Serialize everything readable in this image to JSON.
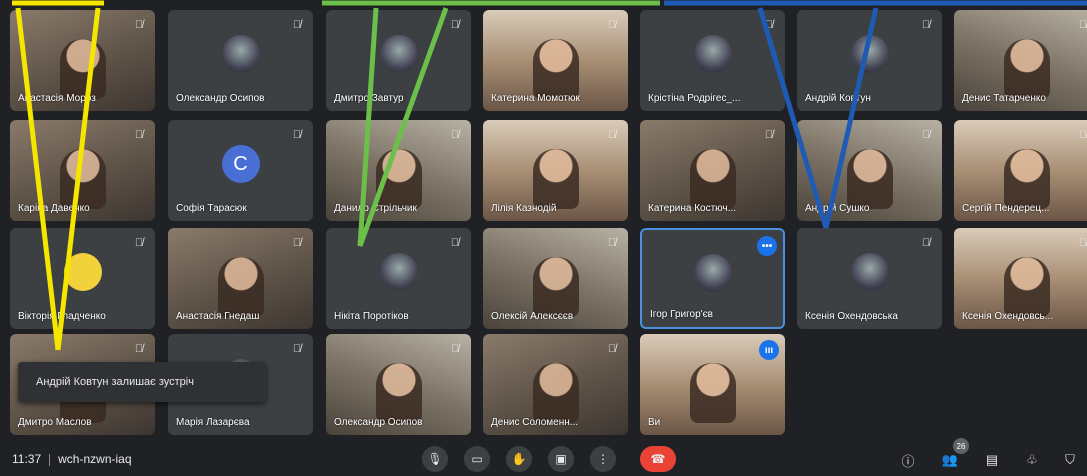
{
  "tiles": [
    {
      "name": "Анастасія Мороз",
      "style": "cam",
      "icon": "person"
    },
    {
      "name": "Олександр Осипов",
      "style": "plain",
      "icon": "avatar"
    },
    {
      "name": "Дмитро Завтур",
      "style": "plain",
      "icon": "avatar"
    },
    {
      "name": "Катерина Момотюк",
      "style": "cam3",
      "icon": "person"
    },
    {
      "name": "Крістіна Родрігес_...",
      "style": "plain",
      "icon": "avatar"
    },
    {
      "name": "Андрій Ковтун",
      "style": "plain",
      "icon": "avatar"
    },
    {
      "name": "Денис Татарченко",
      "style": "cam2",
      "icon": "person"
    },
    {
      "name": "Каріна Давенко",
      "style": "cam",
      "icon": "person"
    },
    {
      "name": "Софія Тарасюк",
      "style": "plain",
      "icon": "letter",
      "letter": "C"
    },
    {
      "name": "Данило Стрільчик",
      "style": "cam2",
      "icon": "person"
    },
    {
      "name": "Лілія Казнодій",
      "style": "cam3",
      "icon": "person"
    },
    {
      "name": "Катерина Костюч...",
      "style": "cam",
      "icon": "person"
    },
    {
      "name": "Андрій Сушко",
      "style": "cam2",
      "icon": "person"
    },
    {
      "name": "Сергій Пендерец...",
      "style": "cam3",
      "icon": "person"
    },
    {
      "name": "Вікторія Гладченко",
      "style": "plain",
      "icon": "emoji"
    },
    {
      "name": "Анастасія Гнедаш",
      "style": "cam",
      "icon": "person"
    },
    {
      "name": "Нікіта Поротіков",
      "style": "plain",
      "icon": "avatar"
    },
    {
      "name": "Олексій Алексєєв",
      "style": "cam2",
      "icon": "person"
    },
    {
      "name": "Ігор Григор'єв",
      "style": "plain",
      "icon": "avatar",
      "active": true,
      "badge": "•••"
    },
    {
      "name": "Ксенія Охендовська",
      "style": "plain",
      "icon": "avatar"
    },
    {
      "name": "Ксенія Охендовсь...",
      "style": "cam3",
      "icon": "person"
    },
    {
      "name": "Дмитро Маслов",
      "style": "cam",
      "icon": "person"
    },
    {
      "name": "Марія Лазарєва",
      "style": "plain",
      "icon": "avatar"
    },
    {
      "name": "Олександр Осипов",
      "style": "cam2",
      "icon": "person"
    },
    {
      "name": "Денис Соломенн...",
      "style": "cam",
      "icon": "person"
    },
    {
      "name": "Ви",
      "style": "cam3",
      "icon": "person",
      "badge": "ııı"
    }
  ],
  "toast": {
    "text": "Андрій Ковтун залишає зустріч"
  },
  "bottombar": {
    "time": "11:37",
    "meeting_code": "wch-nzwn-iaq",
    "people_count": "26",
    "controls": {
      "mic": "🎙",
      "camera": "▭",
      "raise_hand": "✋",
      "present": "▣",
      "more": "⋮",
      "end_call": "☎"
    },
    "right": {
      "info": "ⓘ",
      "people": "👥",
      "chat": "▤",
      "activities": "♧",
      "host": "⛉"
    }
  },
  "annotation_colors": {
    "yellow": "#f5e600",
    "green": "#6cc04a",
    "blue": "#1f5bb5"
  }
}
